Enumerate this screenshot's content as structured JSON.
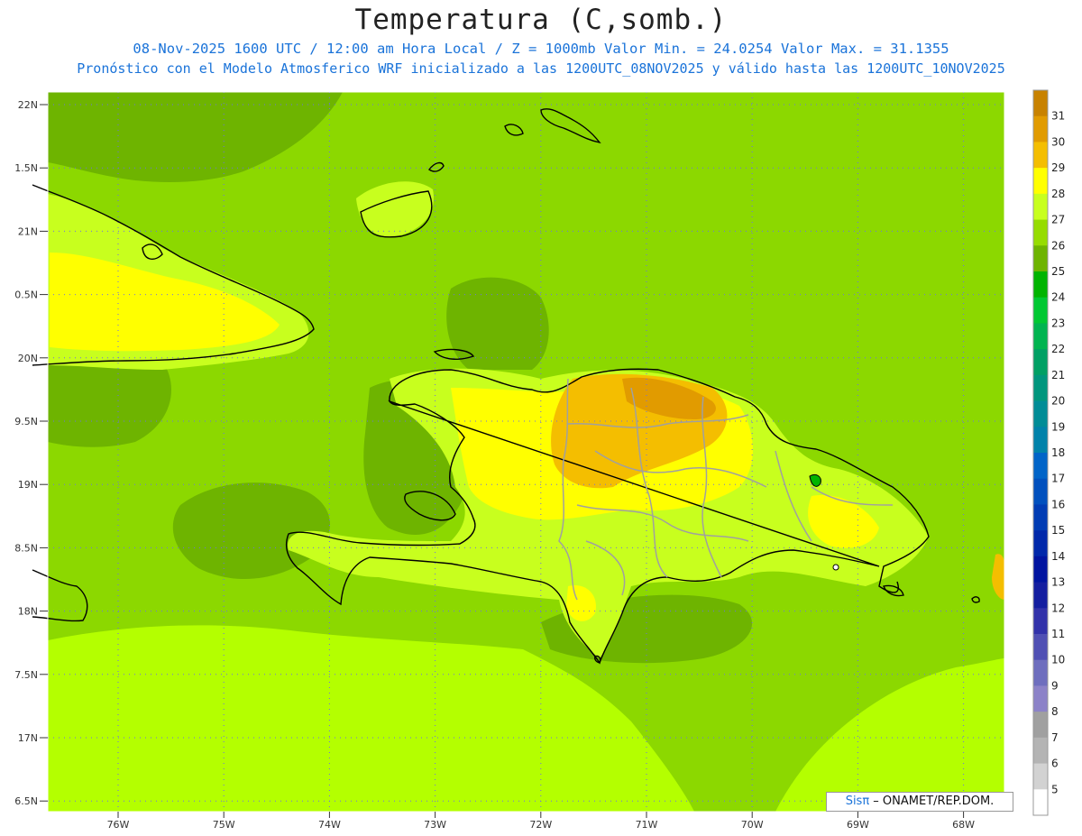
{
  "header": {
    "title": "Temperatura (C,somb.)",
    "line1": "08-Nov-2025 1600 UTC / 12:00 am Hora Local / Z = 1000mb  Valor Min. = 24.0254  Valor Max. = 31.1355",
    "line2": "Pronóstico con el Modelo Atmosferico WRF inicializado a las 1200UTC_08NOV2025 y válido hasta las  1200UTC_10NOV2025"
  },
  "lat_labels": [
    "22N",
    "1.5N",
    "21N",
    "0.5N",
    "20N",
    "9.5N",
    "19N",
    "8.5N",
    "18N",
    "7.5N",
    "17N",
    "6.5N"
  ],
  "lon_labels": [
    "76W",
    "75W",
    "74W",
    "73W",
    "72W",
    "71W",
    "70W",
    "69W",
    "68W"
  ],
  "colorbar": {
    "labels": [
      "31",
      "30",
      "29",
      "28",
      "27",
      "26",
      "25",
      "24",
      "23",
      "22",
      "21",
      "20",
      "19",
      "18",
      "17",
      "16",
      "15",
      "14",
      "13",
      "12",
      "11",
      "10",
      "9",
      "8",
      "7",
      "6",
      "5"
    ],
    "colors": [
      "#c88200",
      "#e19b00",
      "#f4be00",
      "#ffff00",
      "#c8ff1e",
      "#96dc00",
      "#6eb400",
      "#00b400",
      "#00c832",
      "#00b450",
      "#00a064",
      "#00967d",
      "#008c96",
      "#0082aa",
      "#0064c8",
      "#0050be",
      "#003cb4",
      "#0028aa",
      "#0014a0",
      "#141ea0",
      "#3232aa",
      "#5050b4",
      "#6e6ebe",
      "#8c82c8",
      "#a0a0a0",
      "#b4b4b4",
      "#d2d2d2",
      "#ffffff"
    ]
  },
  "legend_colors": {
    "background": "#8cd800",
    "dark_ocean": "#6eb400",
    "light_ocean": "#b4ff00",
    "warm_land": "#ffff00",
    "hot_land": "#f4be00",
    "hottest": "#e19b00",
    "coast": "#000000",
    "borders": "#a0a0a0",
    "grid": "#6e6ee6"
  },
  "credit": {
    "sis": "Sisπ",
    "text": " – ONAMET/REP.DOM."
  }
}
